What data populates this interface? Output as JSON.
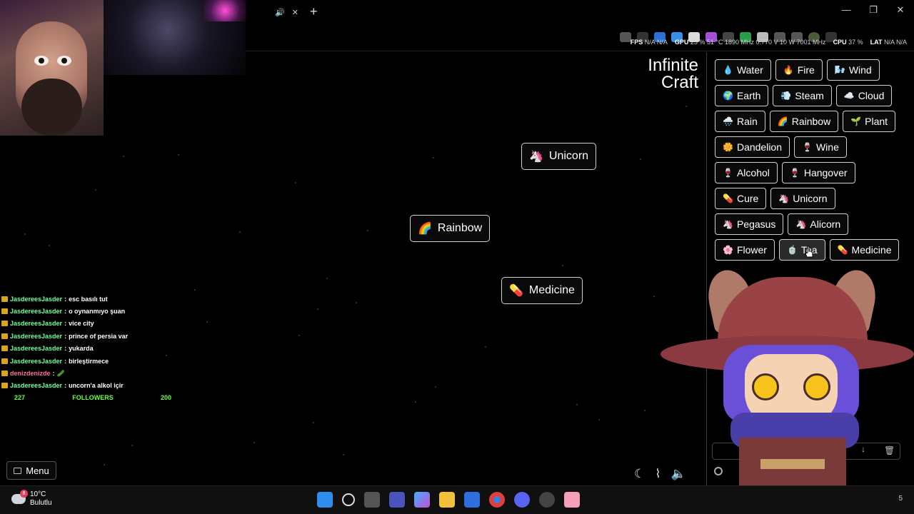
{
  "browser": {
    "tab_audio_icon": "speaker-icon",
    "tab_close": "✕",
    "new_tab": "+",
    "window_controls": {
      "minimize": "—",
      "restore": "❐",
      "close": "✕"
    }
  },
  "perf": {
    "fps_label": "FPS",
    "fps_value": "N/A",
    "fps_value2": "N/A",
    "gpu_label": "GPU",
    "gpu_value": "25 % 51 °C 1890 MHz 0.770 V 10 W 7001 MHz",
    "cpu_label": "CPU",
    "cpu_value": "37 %",
    "lat_label": "LAT",
    "lat_value": "N/A",
    "lat_value2": "N/A"
  },
  "brand": {
    "line1": "Infinite",
    "line2": "Craft"
  },
  "canvas_items": [
    {
      "emoji": "🦄",
      "label": "Unicorn"
    },
    {
      "emoji": "🌈",
      "label": "Rainbow"
    },
    {
      "emoji": "💊",
      "label": "Medicine"
    }
  ],
  "chat": [
    {
      "user": "JasdereesJasder",
      "text": "esc basılı tut"
    },
    {
      "user": "JasdereesJasder",
      "text": "o oynanmıyo şuan"
    },
    {
      "user": "JasdereesJasder",
      "text": "vice city"
    },
    {
      "user": "JasdereesJasder",
      "text": "prince of persia var"
    },
    {
      "user": "JasdereesJasder",
      "text": "yukarda"
    },
    {
      "user": "JasdereesJasder",
      "text": "birleştirmece"
    },
    {
      "user": "denizdenizde",
      "text": "🥒"
    },
    {
      "user": "JasdereesJasder",
      "text": "uncorn'a alkol içir"
    }
  ],
  "followers": {
    "current": "227",
    "label": "FOLLOWERS",
    "goal": "200"
  },
  "menu": {
    "label": "Menu"
  },
  "sidebar_items": [
    {
      "emoji": "💧",
      "label": "Water"
    },
    {
      "emoji": "🔥",
      "label": "Fire"
    },
    {
      "emoji": "🌬️",
      "label": "Wind"
    },
    {
      "emoji": "🌍",
      "label": "Earth"
    },
    {
      "emoji": "💨",
      "label": "Steam"
    },
    {
      "emoji": "☁️",
      "label": "Cloud"
    },
    {
      "emoji": "🌧️",
      "label": "Rain"
    },
    {
      "emoji": "🌈",
      "label": "Rainbow"
    },
    {
      "emoji": "🌱",
      "label": "Plant"
    },
    {
      "emoji": "🌼",
      "label": "Dandelion"
    },
    {
      "emoji": "🍷",
      "label": "Wine"
    },
    {
      "emoji": "🍷",
      "label": "Alcohol"
    },
    {
      "emoji": "🍷",
      "label": "Hangover"
    },
    {
      "emoji": "💊",
      "label": "Cure"
    },
    {
      "emoji": "🦄",
      "label": "Unicorn"
    },
    {
      "emoji": "🦄",
      "label": "Pegasus"
    },
    {
      "emoji": "🦄",
      "label": "Alicorn"
    },
    {
      "emoji": "🌸",
      "label": "Flower"
    },
    {
      "emoji": "🍵",
      "label": "Tea"
    },
    {
      "emoji": "💊",
      "label": "Medicine"
    }
  ],
  "sidebar_bottom": {
    "down": "↓",
    "trash": "🗑"
  },
  "weather": {
    "badge": "8",
    "temp": "10°C",
    "desc": "Bulutlu"
  },
  "tray": {
    "number": "5"
  }
}
